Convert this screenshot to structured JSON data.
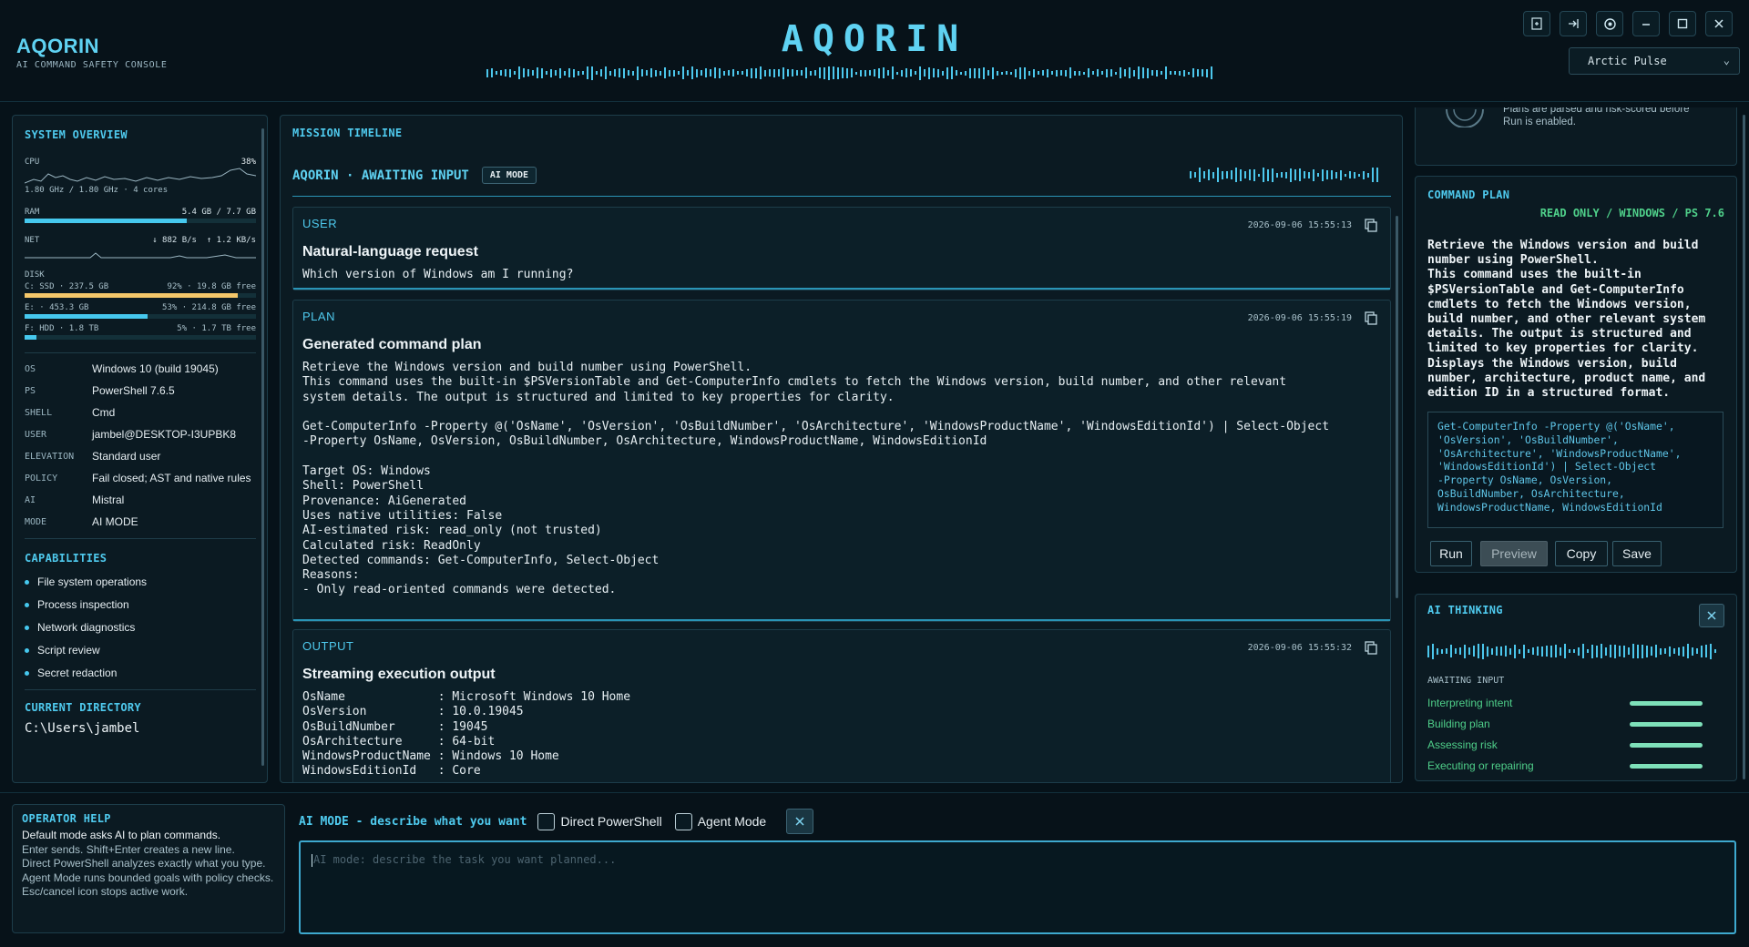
{
  "app": {
    "name": "AQORIN",
    "subtitle": "AI COMMAND SAFETY CONSOLE",
    "big_title": "AQORIN",
    "theme": "Arctic Pulse"
  },
  "window_controls": [
    "export-icon",
    "signout-icon",
    "settings-icon",
    "minimize-icon",
    "maximize-icon",
    "close-icon"
  ],
  "system": {
    "title": "SYSTEM OVERVIEW",
    "cpu": {
      "label": "CPU",
      "percent_text": "38%",
      "percent": 38,
      "detail": "1.80 GHz / 1.80 GHz · 4 cores"
    },
    "ram": {
      "label": "RAM",
      "value": "5.4 GB / 7.7 GB",
      "fraction": 0.7
    },
    "net": {
      "label": "NET",
      "down": "↓ 882 B/s",
      "up": "↑ 1.2 KB/s"
    },
    "disk": {
      "label": "DISK",
      "drives": [
        {
          "name": "C: SSD · 237.5 GB",
          "stat": "92% · 19.8 GB free",
          "fraction": 0.92,
          "color": "#f4c76a"
        },
        {
          "name": "E: · 453.3 GB",
          "stat": "53% · 214.8 GB free",
          "fraction": 0.53,
          "color": "#46c8ee"
        },
        {
          "name": "F: HDD · 1.8 TB",
          "stat": "5% · 1.7 TB free",
          "fraction": 0.05,
          "color": "#46c8ee"
        }
      ]
    },
    "info": [
      {
        "k": "OS",
        "v": "Windows 10 (build 19045)"
      },
      {
        "k": "PS",
        "v": "PowerShell 7.6.5"
      },
      {
        "k": "SHELL",
        "v": "Cmd"
      },
      {
        "k": "USER",
        "v": "jambel@DESKTOP-I3UPBK8"
      },
      {
        "k": "ELEVATION",
        "v": "Standard user"
      },
      {
        "k": "POLICY",
        "v": "Fail closed; AST and native rules"
      },
      {
        "k": "AI",
        "v": "Mistral"
      },
      {
        "k": "MODE",
        "v": "AI MODE"
      }
    ],
    "capabilities_title": "CAPABILITIES",
    "capabilities": [
      "File system operations",
      "Process inspection",
      "Network diagnostics",
      "Script review",
      "Secret redaction"
    ],
    "directory_title": "CURRENT DIRECTORY",
    "directory": "C:\\Users\\jambel"
  },
  "timeline": {
    "title": "MISSION TIMELINE",
    "status": "AQORIN · AWAITING INPUT",
    "mode_pill": "AI MODE",
    "entries": [
      {
        "kind": "USER",
        "time": "2026-09-06 15:55:13",
        "heading": "Natural-language request",
        "body": "Which version of Windows am I running?"
      },
      {
        "kind": "PLAN",
        "time": "2026-09-06 15:55:19",
        "heading": "Generated command plan",
        "body": "Retrieve the Windows version and build number using PowerShell.\nThis command uses the built-in $PSVersionTable and Get-ComputerInfo cmdlets to fetch the Windows version, build number, and other relevant\nsystem details. The output is structured and limited to key properties for clarity.\n\nGet-ComputerInfo -Property @('OsName', 'OsVersion', 'OsBuildNumber', 'OsArchitecture', 'WindowsProductName', 'WindowsEditionId') | Select-Object\n-Property OsName, OsVersion, OsBuildNumber, OsArchitecture, WindowsProductName, WindowsEditionId\n\nTarget OS: Windows\nShell: PowerShell\nProvenance: AiGenerated\nUses native utilities: False\nAI-estimated risk: read_only (not trusted)\nCalculated risk: ReadOnly\nDetected commands: Get-ComputerInfo, Select-Object\nReasons:\n- Only read-oriented commands were detected."
      },
      {
        "kind": "OUTPUT",
        "time": "2026-09-06 15:55:32",
        "heading": "Streaming execution output",
        "body": "OsName             : Microsoft Windows 10 Home\nOsVersion          : 10.0.19045\nOsBuildNumber      : 19045\nOsArchitecture     : 64-bit\nWindowsProductName : Windows 10 Home\nWindowsEditionId   : Core"
      }
    ]
  },
  "right_top": {
    "note": "Plans are parsed and risk-scored before\nRun is enabled."
  },
  "command_plan": {
    "title": "COMMAND PLAN",
    "badge": "READ ONLY / WINDOWS / PS 7.6",
    "description": "Retrieve the Windows version and build\nnumber using PowerShell.\nThis command uses the built-in\n$PSVersionTable and Get-ComputerInfo\ncmdlets to fetch the Windows version,\nbuild number, and other relevant system\ndetails. The output is structured and\nlimited to key properties for clarity.\nDisplays the Windows version, build\nnumber, architecture, product name, and\nedition ID in a structured format.",
    "code": "Get-ComputerInfo -Property @('OsName',\n'OsVersion', 'OsBuildNumber',\n'OsArchitecture', 'WindowsProductName',\n'WindowsEditionId') | Select-Object\n-Property OsName, OsVersion,\nOsBuildNumber, OsArchitecture,\nWindowsProductName, WindowsEditionId",
    "buttons": {
      "run": "Run",
      "preview": "Preview",
      "copy": "Copy",
      "save": "Save"
    }
  },
  "thinking": {
    "title": "AI THINKING",
    "state": "AWAITING INPUT",
    "steps": [
      "Interpreting intent",
      "Building plan",
      "Assessing risk",
      "Executing or repairing"
    ]
  },
  "help": {
    "title": "OPERATOR HELP",
    "lines": [
      "Default mode asks AI to plan commands.",
      "Enter sends. Shift+Enter creates a new line.",
      "Direct PowerShell analyzes exactly what you type.",
      "Agent Mode runs bounded goals with policy checks.",
      "Esc/cancel icon stops active work."
    ]
  },
  "input": {
    "mode_label": "AI MODE - describe what you want",
    "direct_label": "Direct PowerShell",
    "agent_label": "Agent Mode",
    "placeholder": "AI mode: describe the task you want planned..."
  }
}
